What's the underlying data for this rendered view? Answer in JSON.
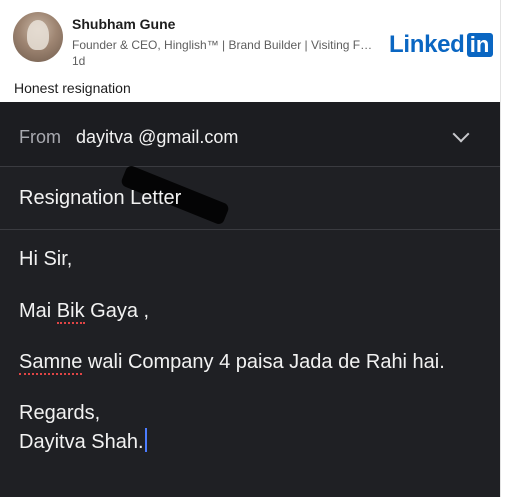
{
  "post": {
    "author_name": "Shubham Gune",
    "author_headline": "Founder & CEO, Hinglish™ | Brand Builder | Visiting Fac…",
    "post_age": "1d",
    "brand_logo_text": "Linked",
    "brand_logo_box": "in",
    "caption": "Honest resignation"
  },
  "email": {
    "from_label": "From",
    "from_value_prefix": "dayitva",
    "from_value_suffix": "@gmail.com",
    "subject": "Resignation Letter",
    "greeting": "Hi Sir,",
    "line1_word1": "Mai ",
    "line1_word2": "Bik",
    "line1_word3": " Gaya ,",
    "line2_word1": "Samne",
    "line2_rest": " wali Company 4 paisa Jada de Rahi hai.",
    "signoff": "Regards,",
    "signature": "Dayitva Shah."
  },
  "colors": {
    "linkedin_blue": "#0a66c2",
    "email_bg": "#1f2024",
    "spellcheck_underline": "#e04545",
    "cursor": "#4b7cff"
  },
  "icons": {
    "dropdown": "chevron-down-icon"
  }
}
